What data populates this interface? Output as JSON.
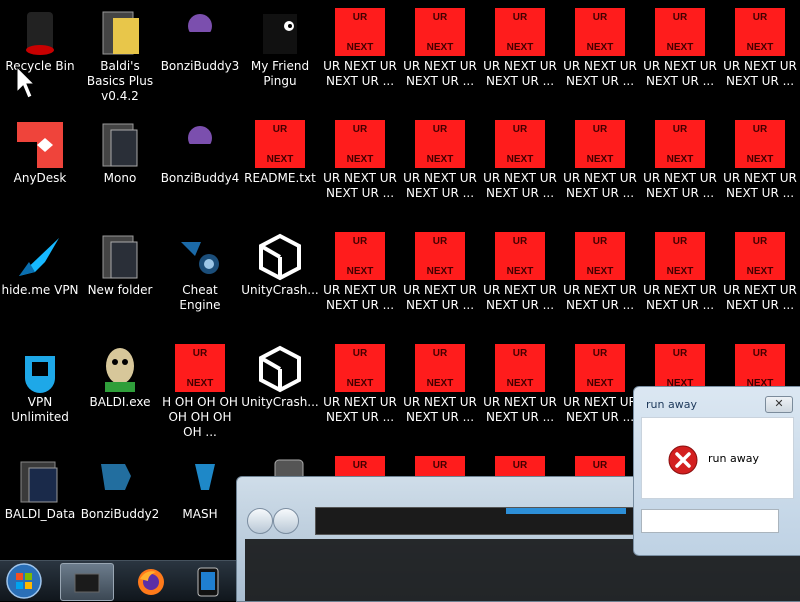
{
  "desktop": {
    "col1": [
      "Recycle Bin",
      "AnyDesk",
      "hide.me VPN",
      "VPN Unlimited",
      "BALDI_Data"
    ],
    "col2": [
      "Baldi's Basics Plus v0.4.2",
      "Mono",
      "New folder",
      "BALDI.exe",
      "BonziBuddy2"
    ],
    "col3": [
      "BonziBuddy3",
      "BonziBuddy4",
      "Cheat Engine",
      "H OH OH OH OH OH OH OH ...",
      "MASH"
    ],
    "col4": [
      "My Friend Pingu",
      "README.txt",
      "UnityCrash...",
      "UnityCrash..."
    ],
    "ur_label": "UR NEXT UR NEXT UR ...",
    "ur_top": "UR",
    "ur_bottom": "NEXT"
  },
  "dialog": {
    "title": "run away",
    "message": "run away",
    "close_glyph": "✕"
  },
  "colors": {
    "ur_red": "#ff1c1c",
    "error_red": "#d32020",
    "taskbar": "#1b232b"
  }
}
